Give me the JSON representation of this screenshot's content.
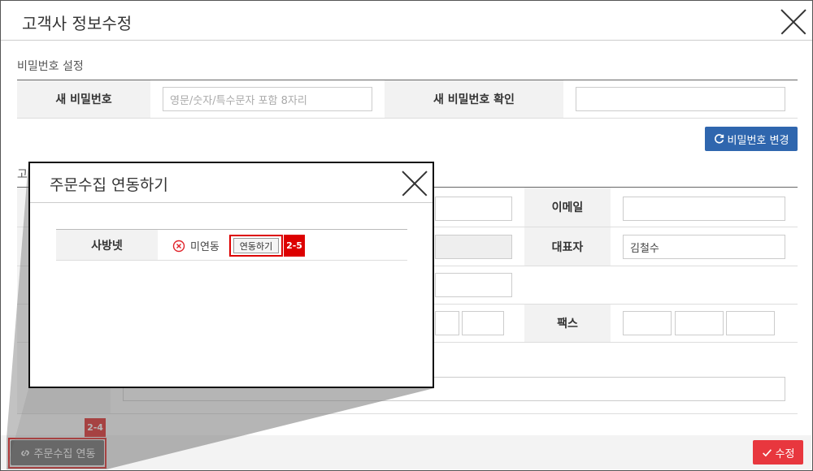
{
  "dialog": {
    "title": "고객사 정보수정",
    "password_section": {
      "label": "비밀번호 설정",
      "new_password_label": "새 비밀번호",
      "new_password_placeholder": "영문/숫자/특수문자 포함 8자리",
      "new_password_value": "",
      "confirm_label": "새 비밀번호 확인",
      "confirm_value": "",
      "change_button": "비밀번호 변경"
    },
    "info_section": {
      "label_fragment": "고",
      "email_label": "이메일",
      "email_value": "",
      "ceo_label": "대표자",
      "ceo_value": "김철수",
      "fax_label": "팩스"
    },
    "footer": {
      "order_link_button": "주문수집 연동",
      "submit_button": "수정"
    }
  },
  "popup": {
    "title": "주문수집 연동하기",
    "service_label": "사방넷",
    "status_text": "미연동",
    "connect_button": "연동하기"
  },
  "callouts": {
    "footer_badge": "2-4",
    "popup_badge": "2-5"
  },
  "colors": {
    "primary_blue": "#2f66ae",
    "submit_red": "#e8373e",
    "callout_red": "#dd0000",
    "status_error": "#e0232a"
  }
}
